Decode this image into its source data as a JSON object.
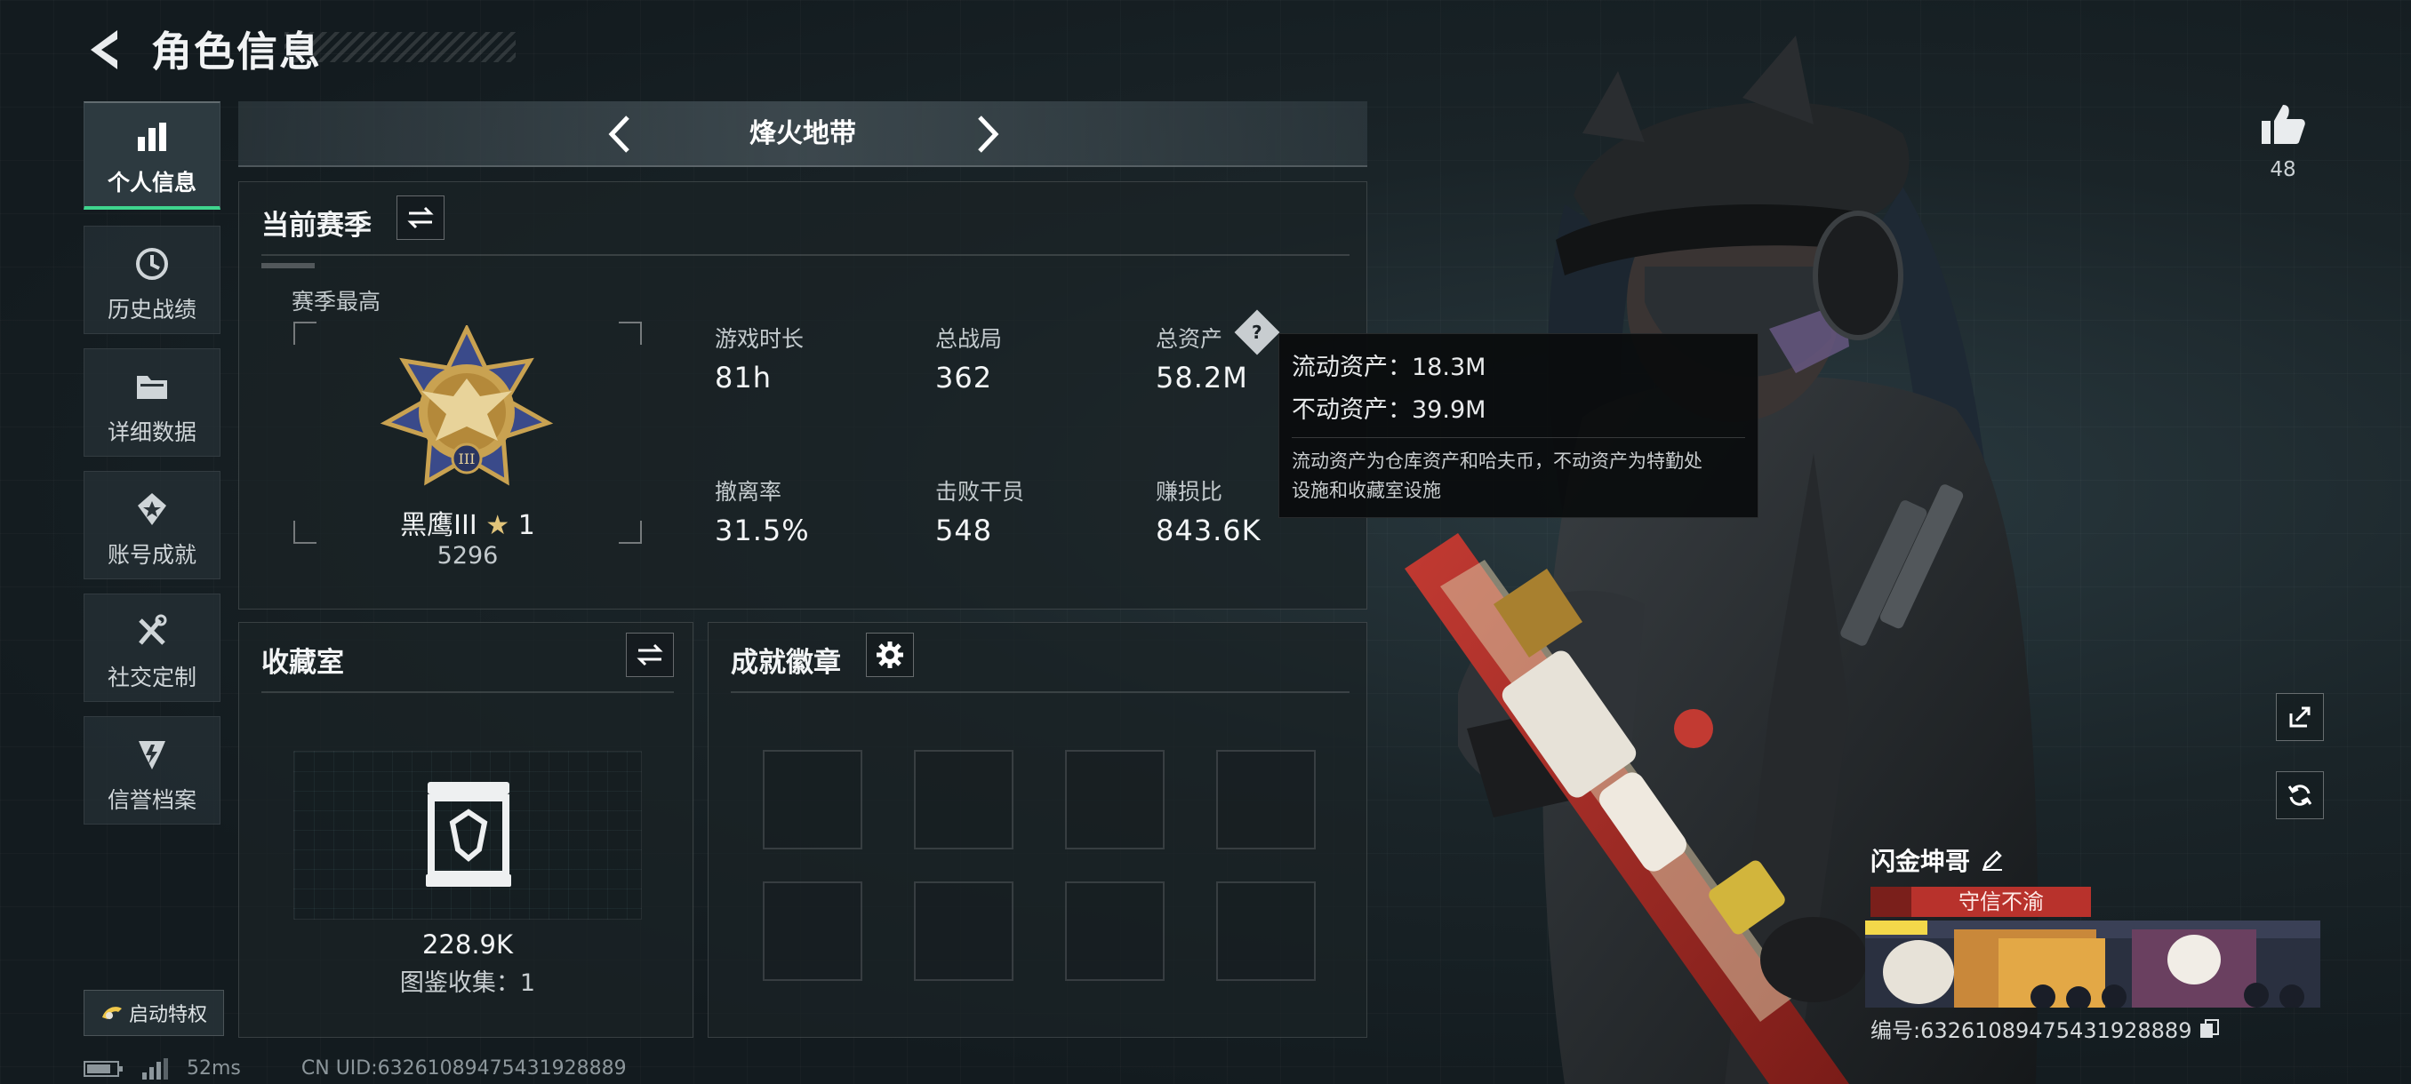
{
  "header": {
    "title": "角色信息"
  },
  "sidebar": {
    "items": [
      {
        "label": "个人信息",
        "icon": "bar-chart-icon",
        "active": true
      },
      {
        "label": "历史战绩",
        "icon": "history-clock-icon",
        "active": false
      },
      {
        "label": "详细数据",
        "icon": "folder-icon",
        "active": false
      },
      {
        "label": "账号成就",
        "icon": "achievement-star-icon",
        "active": false
      },
      {
        "label": "社交定制",
        "icon": "tools-icon",
        "active": false
      },
      {
        "label": "信誉档案",
        "icon": "credit-shield-icon",
        "active": false
      }
    ],
    "launch_label": "启动特权"
  },
  "mode": {
    "title": "烽火地带"
  },
  "season": {
    "title": "当前赛季",
    "best_label": "赛季最高",
    "rank_name": "黑鹰III",
    "rank_stars": "1",
    "rank_score": "5296",
    "stats": [
      {
        "label": "游戏时长",
        "value": "81h"
      },
      {
        "label": "总战局",
        "value": "362"
      },
      {
        "label": "总资产",
        "value": "58.2M"
      },
      {
        "label": "撤离率",
        "value": "31.5%"
      },
      {
        "label": "击败干员",
        "value": "548"
      },
      {
        "label": "赚损比",
        "value": "843.6K"
      }
    ]
  },
  "tooltip": {
    "liquid": "流动资产：18.3M",
    "fixed": "不动资产：39.9M",
    "note_line1": "流动资产为仓库资产和哈夫币，不动资产为特勤处",
    "note_line2": "设施和收藏室设施"
  },
  "collection": {
    "title": "收藏室",
    "value": "228.9K",
    "count_label": "图鉴收集：1"
  },
  "badges": {
    "title": "成就徽章"
  },
  "profile": {
    "likes": "48",
    "name": "闪金坤哥",
    "motto": "守信不渝",
    "id_label": "编号:63261089475431928889"
  },
  "status": {
    "ping": "52ms",
    "uid": "CN UID:63261089475431928889"
  },
  "colors": {
    "accent": "#3fd58e",
    "motto_bg": "#b8322c",
    "background": "#141d22"
  }
}
